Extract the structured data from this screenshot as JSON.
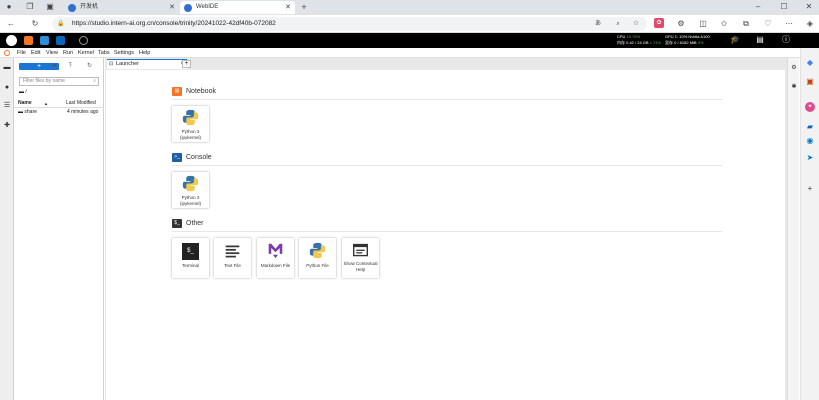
{
  "browser": {
    "tabs": [
      {
        "title": "开发机"
      },
      {
        "title": "WebIDE"
      }
    ],
    "new_tab": "+",
    "url": "https://studio.intern-ai.org.cn/console/trinity/20241022-42df40b-072082",
    "window_controls": {
      "minimize": "–",
      "maximize": "☐",
      "close": "✕"
    }
  },
  "ide_topbar": {
    "stats": {
      "cpu_label": "CPU",
      "cpu_value": "19.76%",
      "mem_label": "内存",
      "mem_value": "0.42 / 24 GB",
      "mem_pct": "1.74%",
      "gpu_label": "GPU",
      "gpu_value": "1: 10% Nvidia A100",
      "gpu_mem_label": "显存",
      "gpu_mem_value": "0 / 8182 MiB",
      "gpu_mem_pct": "0%"
    }
  },
  "menu": [
    "File",
    "Edit",
    "View",
    "Run",
    "Kernel",
    "Tabs",
    "Settings",
    "Help"
  ],
  "filebrowser": {
    "new_button": "+",
    "filter_placeholder": "Filter files by name",
    "path": "/",
    "col_name": "Name",
    "sort_indicator": "▲",
    "col_modified": "Last Modified",
    "files": [
      {
        "name": "share",
        "modified": "4 minutes ago"
      }
    ]
  },
  "doc_tab": {
    "label": "Launcher",
    "close": "×",
    "add": "+"
  },
  "launcher": {
    "notebook": {
      "title": "Notebook",
      "cards": [
        {
          "label": "Python 3 (ipykernel)"
        }
      ]
    },
    "console": {
      "title": "Console",
      "cards": [
        {
          "label": "Python 3 (ipykernel)"
        }
      ]
    },
    "other": {
      "title": "Other",
      "cards": [
        {
          "label": "Terminal"
        },
        {
          "label": "Text File"
        },
        {
          "label": "Markdown File"
        },
        {
          "label": "Python File"
        },
        {
          "label": "Show Contextual Help"
        }
      ]
    }
  },
  "colors": {
    "accent": "#1976d2",
    "notebook_icon": "#f37626",
    "console_icon": "#1c5fa5",
    "other_icon": "#333333",
    "python_blue": "#3572a5",
    "python_yellow": "#f2c94c",
    "markdown_purple": "#7b3ea8"
  }
}
